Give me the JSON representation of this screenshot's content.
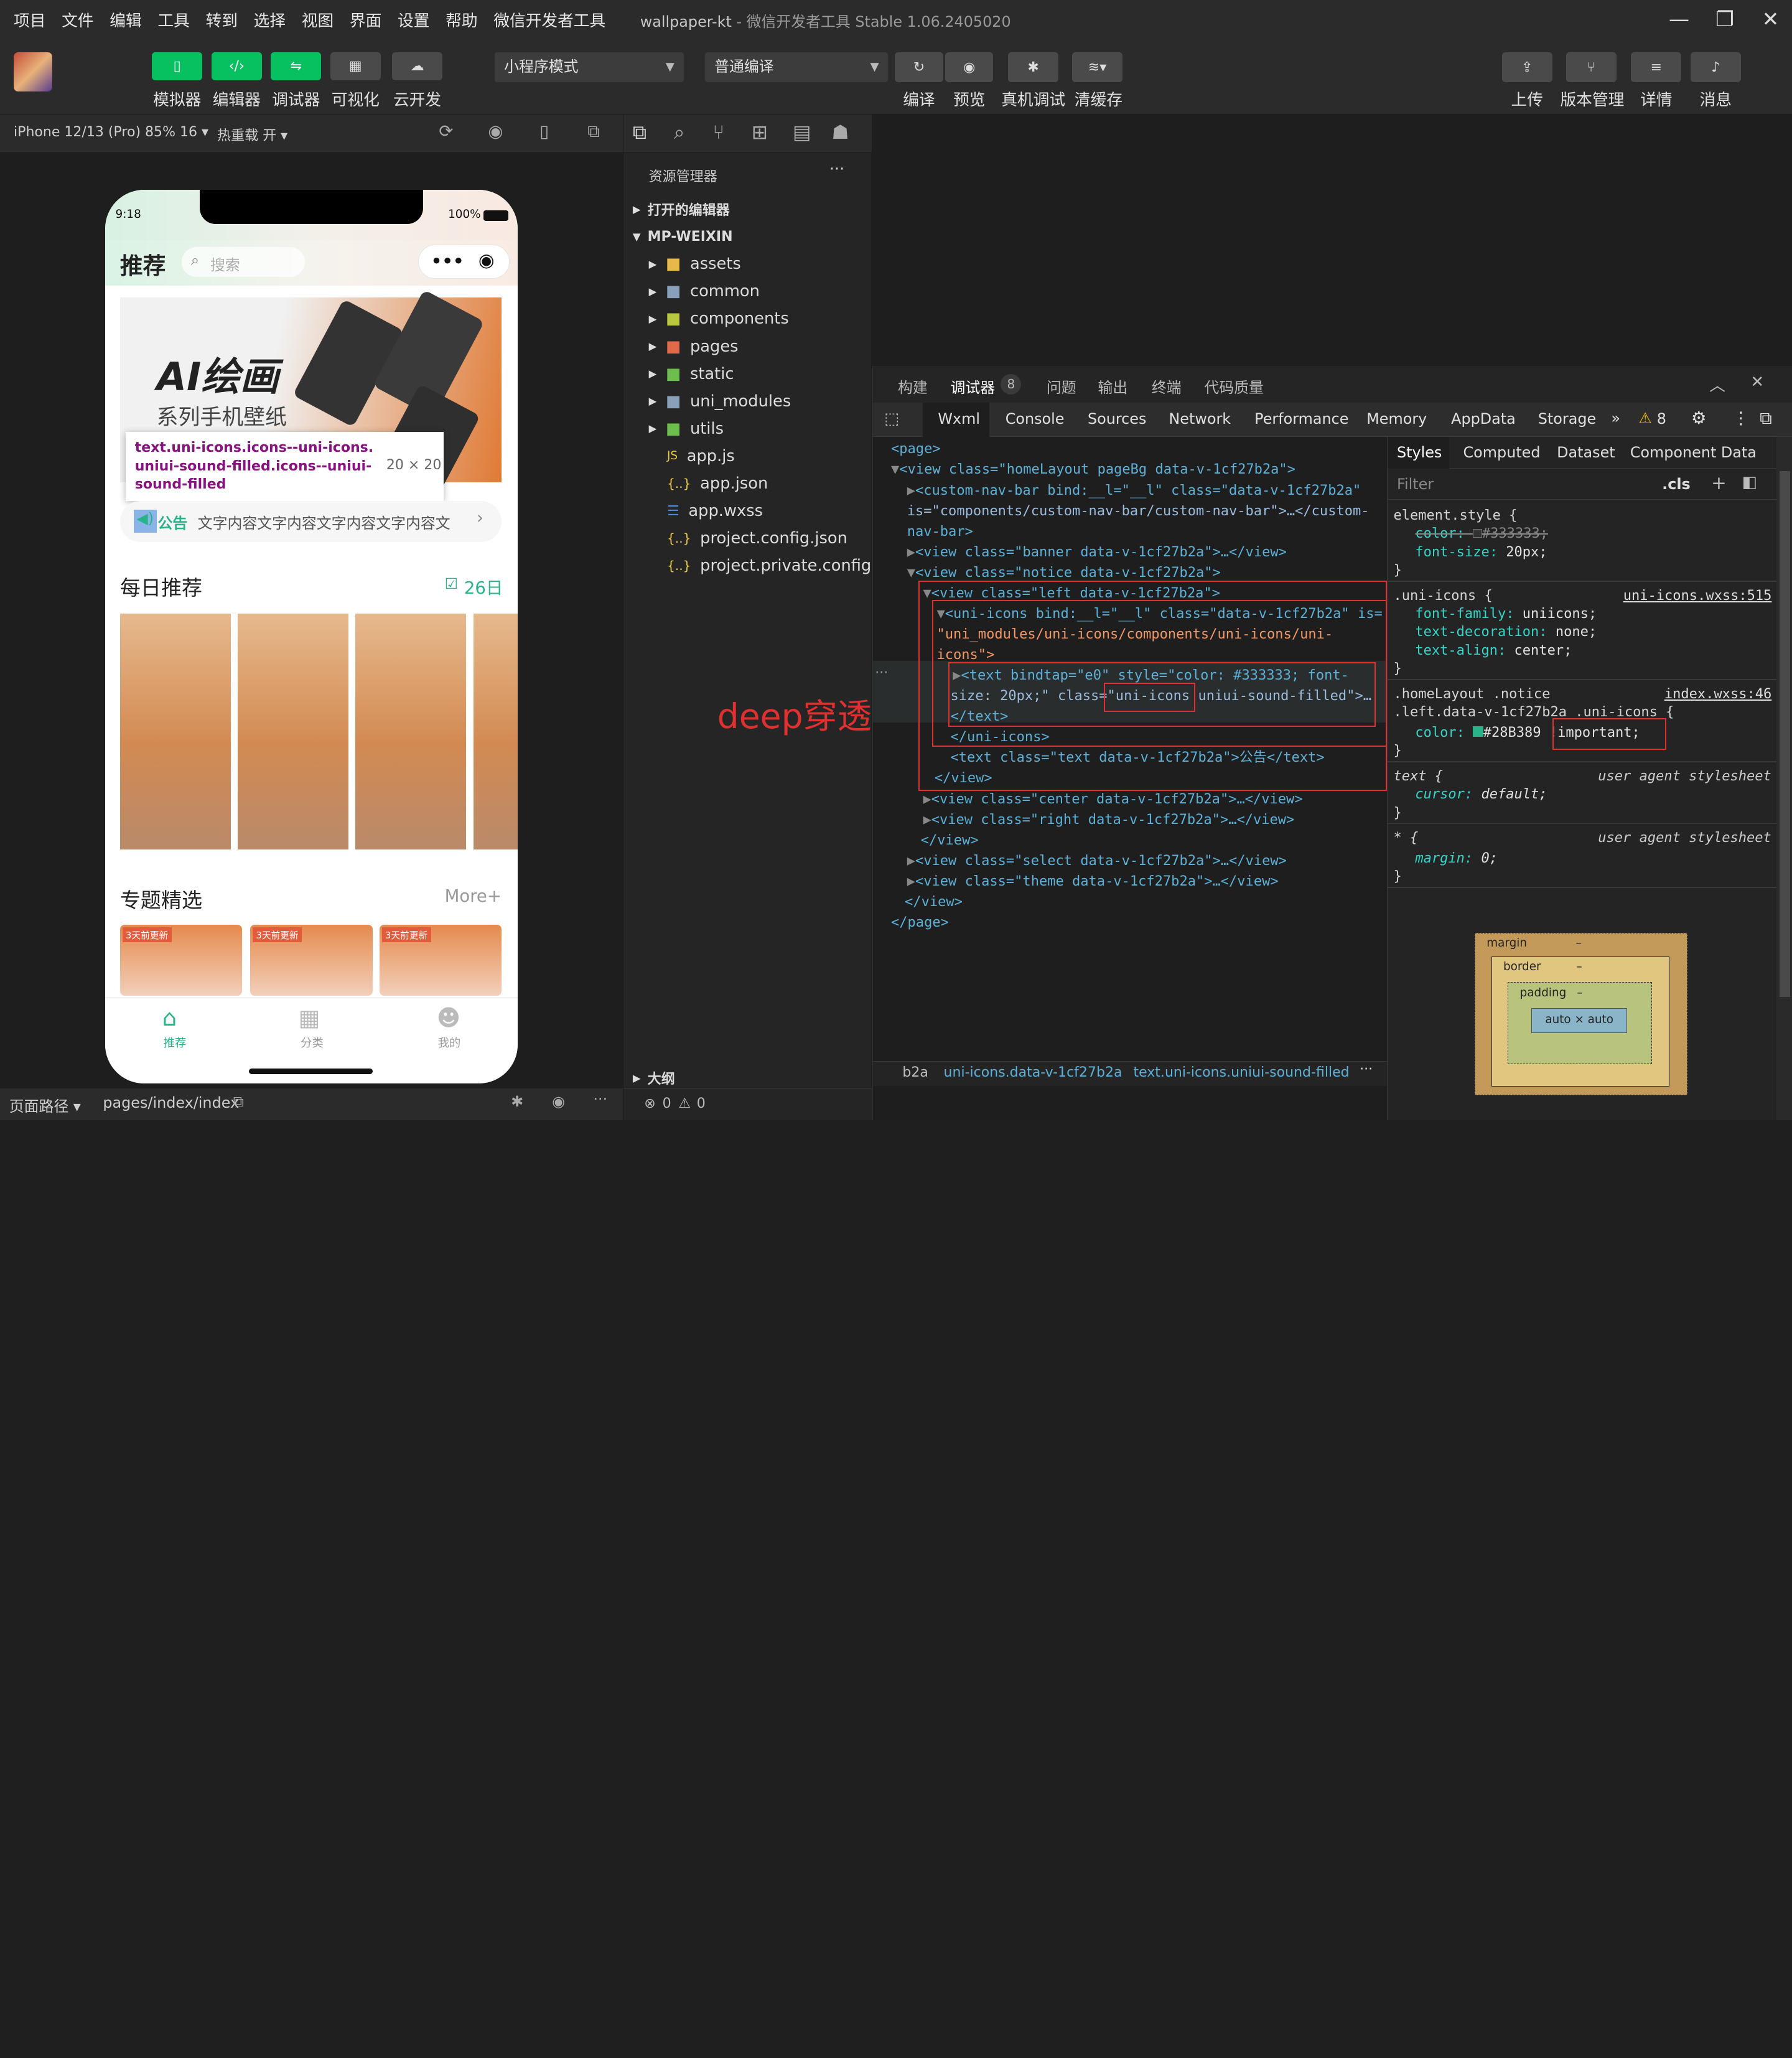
{
  "menu": {
    "items": [
      "项目",
      "文件",
      "编辑",
      "工具",
      "转到",
      "选择",
      "视图",
      "界面",
      "设置",
      "帮助",
      "微信开发者工具"
    ],
    "window_title": "wallpaper-kt",
    "window_subtitle": " - 微信开发者工具 Stable 1.06.2405020"
  },
  "toolbar": {
    "left_buttons": [
      "模拟器",
      "编辑器",
      "调试器",
      "可视化",
      "云开发"
    ],
    "mode_select": "小程序模式",
    "compile_select": "普通编译",
    "center_buttons": [
      "编译",
      "预览",
      "真机调试",
      "清缓存"
    ],
    "right_buttons": [
      "上传",
      "版本管理",
      "详情",
      "消息"
    ]
  },
  "simulator": {
    "device": "iPhone 12/13 (Pro) 85% 16",
    "hot_reload": "热重载 开",
    "footer_path_label": "页面路径",
    "footer_path": "pages/index/index"
  },
  "phone": {
    "time": "9:18",
    "battery": "100%",
    "header_title": "推荐",
    "search_placeholder": "搜索",
    "banner_title": "AI绘画",
    "banner_subtitle": "系列手机壁纸",
    "tooltip_selector": "text.uni-icons.icons--uni-icons.uniui-sound-filled.icons--uniui-sound-filled",
    "tooltip_size": "20 × 20",
    "notice_label": "公告",
    "notice_text": "文字内容文字内容文字内容文字内容文",
    "daily_title": "每日推荐",
    "daily_date": "26日",
    "topics_title": "专题精选",
    "topics_more": "More+",
    "topic_badge": "3天前更新",
    "tabs": [
      "推荐",
      "分类",
      "我的"
    ]
  },
  "explorer": {
    "title": "资源管理器",
    "open_editors": "打开的编辑器",
    "project": "MP-WEIXIN",
    "folders": [
      "assets",
      "common",
      "components",
      "pages",
      "static",
      "uni_modules",
      "utils"
    ],
    "files": [
      "app.js",
      "app.json",
      "app.wxss",
      "project.config.json",
      "project.private.config.js..."
    ],
    "outline": "大纲",
    "status_errors": "0",
    "status_warnings": "0"
  },
  "devtools": {
    "top_tabs": [
      "构建",
      "调试器",
      "问题",
      "输出",
      "终端",
      "代码质量"
    ],
    "debugger_badge": "8",
    "tabs": [
      "Wxml",
      "Console",
      "Sources",
      "Network",
      "Performance",
      "Memory",
      "AppData",
      "Storage"
    ],
    "warning_count": "8",
    "wxml_lines": [
      "<page>",
      "<view class=\"homeLayout pageBg data-v-1cf27b2a\">",
      "<custom-nav-bar bind:__l=\"__l\" class=\"data-v-1cf27b2a\"",
      "is=\"components/custom-nav-bar/custom-nav-bar\">…</custom-",
      "nav-bar>",
      "<view class=\"banner data-v-1cf27b2a\">…</view>",
      "<view class=\"notice data-v-1cf27b2a\">",
      "<view class=\"left data-v-1cf27b2a\">",
      "<uni-icons bind:__l=\"__l\" class=\"data-v-1cf27b2a\" is=",
      "\"uni_modules/uni-icons/components/uni-icons/uni-",
      "icons\">",
      "<text bindtap=\"e0\" style=\"color: #333333; font-",
      "size: 20px;\" class=\"uni-icons uniui-sound-filled\">…",
      "</text>",
      "</uni-icons>",
      "<text class=\"text data-v-1cf27b2a\">公告</text>",
      "</view>",
      "<view class=\"center data-v-1cf27b2a\">…</view>",
      "<view class=\"right data-v-1cf27b2a\">…</view>",
      "</view>",
      "<view class=\"select data-v-1cf27b2a\">…</view>",
      "<view class=\"theme data-v-1cf27b2a\">…</view>",
      "</view>",
      "</page>"
    ],
    "annotation": "deep穿透",
    "breadcrumb": [
      "b2a",
      "uni-icons.data-v-1cf27b2a",
      "text.uni-icons.uniui-sound-filled"
    ],
    "styles_tabs": [
      "Styles",
      "Computed",
      "Dataset",
      "Component Data"
    ],
    "filter_placeholder": "Filter",
    "cls": ".cls",
    "rules": [
      {
        "selector": "element.style {",
        "source": "",
        "props": [
          {
            "name": "color:",
            "value": "#333333;",
            "struck": true
          },
          {
            "name": "font-size:",
            "value": "20px;",
            "struck": false
          }
        ]
      },
      {
        "selector": ".uni-icons {",
        "source": "uni-icons.wxss:515",
        "props": [
          {
            "name": "font-family:",
            "value": "uniicons;",
            "struck": false
          },
          {
            "name": "text-decoration:",
            "value": "none;",
            "struck": false
          },
          {
            "name": "text-align:",
            "value": "center;",
            "struck": false
          }
        ]
      },
      {
        "selector": ".homeLayout .notice",
        "selector2": ".left.data-v-1cf27b2a .uni-icons {",
        "source": "index.wxss:46",
        "props": [
          {
            "name": "color:",
            "value": "#28B389",
            "struck": false
          }
        ]
      },
      {
        "selector": "text {",
        "source": "user agent stylesheet",
        "props": [
          {
            "name": "cursor:",
            "value": "default;",
            "struck": false
          }
        ]
      },
      {
        "selector": "* {",
        "source": "user agent stylesheet",
        "props": [
          {
            "name": "margin:",
            "value": "0;",
            "struck": false
          }
        ]
      }
    ],
    "important": "!important;",
    "box_margin": "margin",
    "box_border": "border",
    "box_padding": "padding",
    "box_content": "auto × auto",
    "box_dash": "–"
  }
}
